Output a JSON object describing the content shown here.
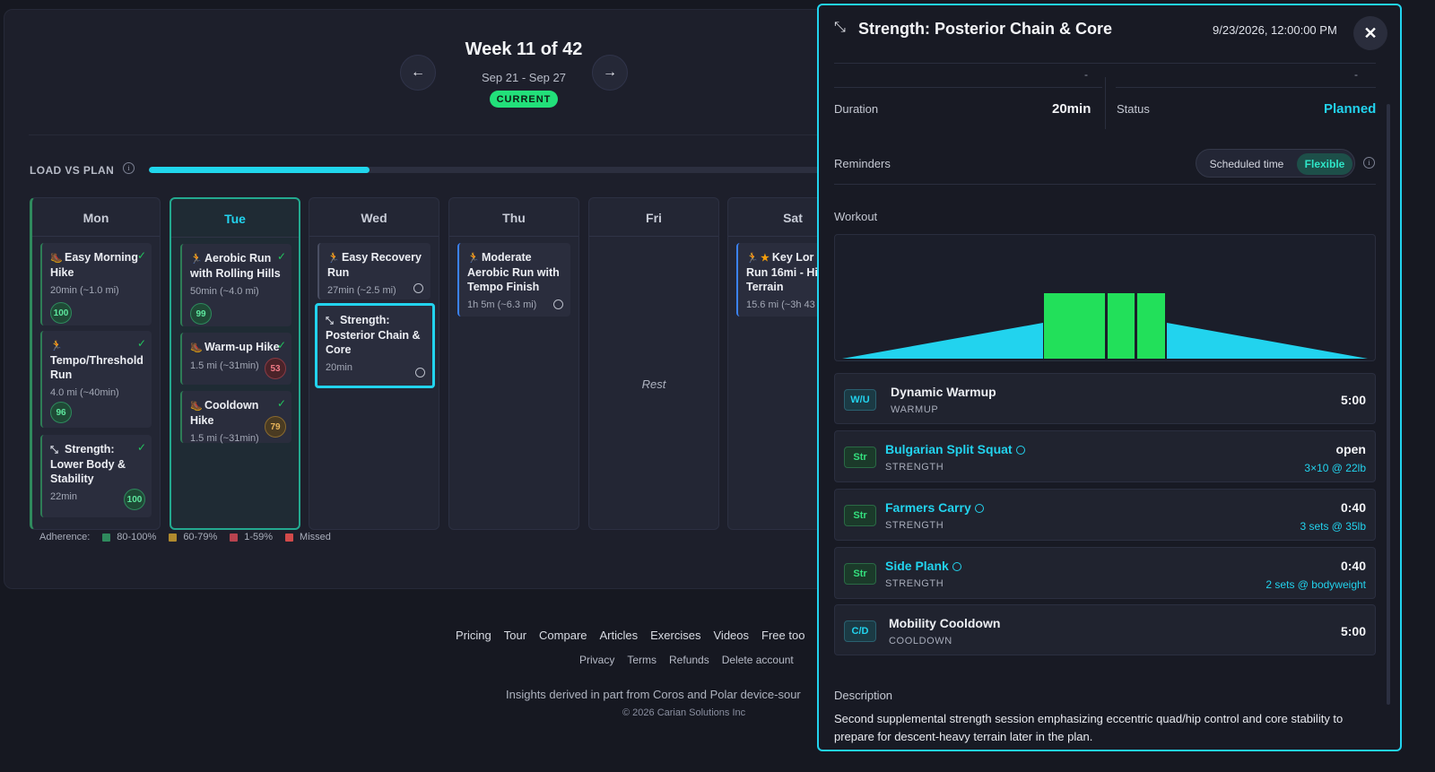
{
  "header": {
    "week_title": "Week 11 of 42",
    "date_range": "Sep 21 - Sep 27",
    "current_badge": "CURRENT",
    "prev_icon": "←",
    "next_icon": "→"
  },
  "load": {
    "label": "LOAD VS PLAN",
    "info": "i",
    "progress": 0.32,
    "color": "#20d6ec"
  },
  "days": {
    "mon": "Mon",
    "tue": "Tue",
    "wed": "Wed",
    "thu": "Thu",
    "fri": "Fri",
    "sat": "Sat",
    "fri_rest": "Rest"
  },
  "workouts": {
    "mon1": {
      "title": "Easy Morning Hike",
      "meta": "20min (~1.0 mi)",
      "score": "100"
    },
    "mon2": {
      "title": "Tempo/Threshold Run",
      "meta": "4.0 mi (~40min)",
      "score": "96"
    },
    "mon3": {
      "title": "Strength: Lower Body & Stability",
      "meta": "22min",
      "score": "100"
    },
    "tue1": {
      "title": "Aerobic Run with Rolling Hills",
      "meta": "50min (~4.0 mi)",
      "score": "99"
    },
    "tue2": {
      "title": "Warm-up Hike",
      "meta": "1.5 mi (~31min)",
      "score": "53"
    },
    "tue3": {
      "title": "Cooldown Hike",
      "meta": "1.5 mi (~31min)",
      "score": "79"
    },
    "wed1": {
      "title": "Easy Recovery Run",
      "meta": "27min (~2.5 mi)"
    },
    "wed2": {
      "title": "Strength: Posterior Chain & Core",
      "meta": "20min"
    },
    "thu1": {
      "title": "Moderate Aerobic Run with Tempo Finish",
      "meta": "1h 5m (~6.3 mi)"
    },
    "sat1": {
      "title_line1": "Key Lor",
      "title_line2": "Run 16mi - Hil",
      "title_line3": "Terrain",
      "meta": "15.6 mi (~3h 43"
    },
    "check": "✓",
    "star": "★"
  },
  "legend": {
    "label": "Adherence:",
    "items": [
      {
        "label": "80-100%",
        "color": "#2f8a5d"
      },
      {
        "label": "60-79%",
        "color": "#b08a2e"
      },
      {
        "label": "1-59%",
        "color": "#b8434f"
      },
      {
        "label": "Missed",
        "color": "#d24a4a"
      }
    ]
  },
  "footer": {
    "links": [
      "Pricing",
      "Tour",
      "Compare",
      "Articles",
      "Exercises",
      "Videos",
      "Free too"
    ],
    "links2": [
      "Privacy",
      "Terms",
      "Refunds",
      "Delete account"
    ],
    "insights": "Insights derived in part from Coros and Polar device-sour",
    "copyright": "© 2026 Carian Solutions Inc"
  },
  "drawer": {
    "title": "Strength: Posterior Chain & Core",
    "datetime": "9/23/2026, 12:00:00 PM",
    "close": "✕",
    "dash_left": "-",
    "dash_right": "-",
    "duration_label": "Duration",
    "duration_value": "20min",
    "status_label": "Status",
    "status_value": "Planned",
    "reminders_label": "Reminders",
    "reminder_options": [
      "Scheduled time",
      "Flexible"
    ],
    "workout_label": "Workout",
    "steps": [
      {
        "tag": "W/U",
        "name": "Dynamic Warmup",
        "category": "WARMUP",
        "time": "5:00",
        "sub": ""
      },
      {
        "tag": "Str",
        "name": "Bulgarian Split Squat",
        "category": "STRENGTH",
        "time": "open",
        "sub": "3×10 @ 22lb"
      },
      {
        "tag": "Str",
        "name": "Farmers Carry",
        "category": "STRENGTH",
        "time": "0:40",
        "sub": "3 sets @ 35lb"
      },
      {
        "tag": "Str",
        "name": "Side Plank",
        "category": "STRENGTH",
        "time": "0:40",
        "sub": "2 sets @ bodyweight"
      },
      {
        "tag": "C/D",
        "name": "Mobility Cooldown",
        "category": "COOLDOWN",
        "time": "5:00",
        "sub": ""
      }
    ],
    "description_label": "Description",
    "description": "Second supplemental strength session emphasizing eccentric quad/hip control and core stability to prepare for descent-heavy terrain later in the plan."
  }
}
